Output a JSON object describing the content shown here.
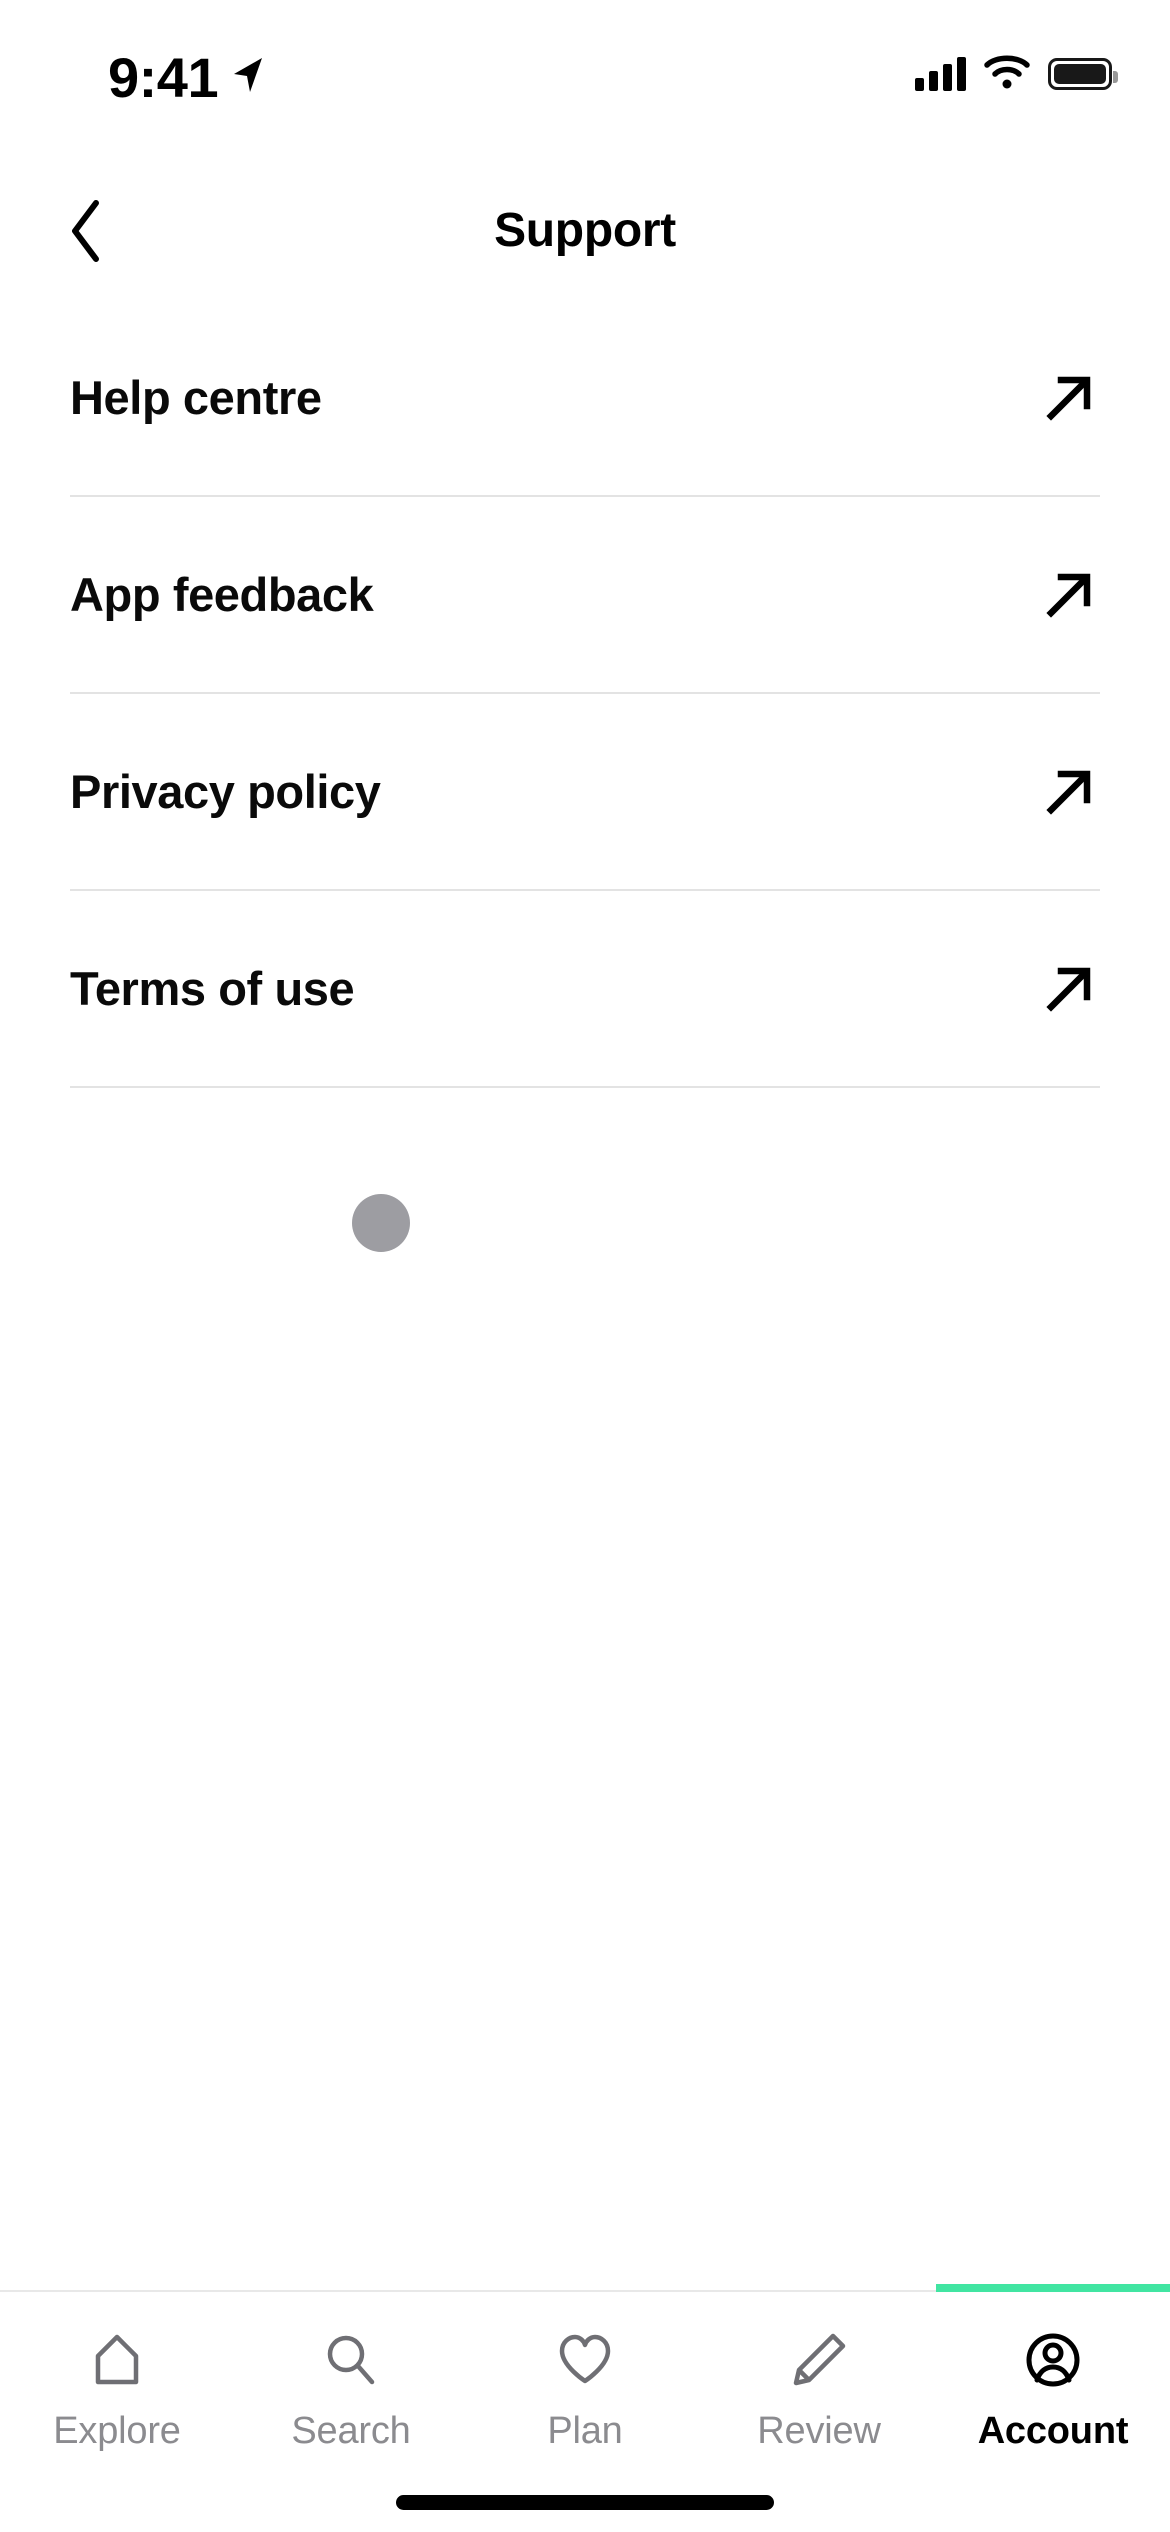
{
  "status_bar": {
    "time": "9:41",
    "location_icon": "location-arrow-icon",
    "signal_icon": "cellular-signal-icon",
    "wifi_icon": "wifi-icon",
    "battery_icon": "battery-full-icon"
  },
  "header": {
    "back_icon": "chevron-left-icon",
    "title": "Support"
  },
  "list": {
    "items": [
      {
        "label": "Help centre",
        "icon": "external-link-arrow-icon"
      },
      {
        "label": "App feedback",
        "icon": "external-link-arrow-icon"
      },
      {
        "label": "Privacy policy",
        "icon": "external-link-arrow-icon"
      },
      {
        "label": "Terms of use",
        "icon": "external-link-arrow-icon"
      }
    ]
  },
  "loading_dot": {
    "name": "loading-dot",
    "color": "#9d9da2"
  },
  "tab_bar": {
    "accent_color": "#41e5a2",
    "inactive_color": "#8b8b8f",
    "active_color": "#000000",
    "items": [
      {
        "label": "Explore",
        "icon": "home-icon",
        "active": false
      },
      {
        "label": "Search",
        "icon": "search-icon",
        "active": false
      },
      {
        "label": "Plan",
        "icon": "heart-icon",
        "active": false
      },
      {
        "label": "Review",
        "icon": "pencil-icon",
        "active": false
      },
      {
        "label": "Account",
        "icon": "account-circle-icon",
        "active": true
      }
    ]
  },
  "home_indicator": {
    "name": "home-indicator"
  }
}
